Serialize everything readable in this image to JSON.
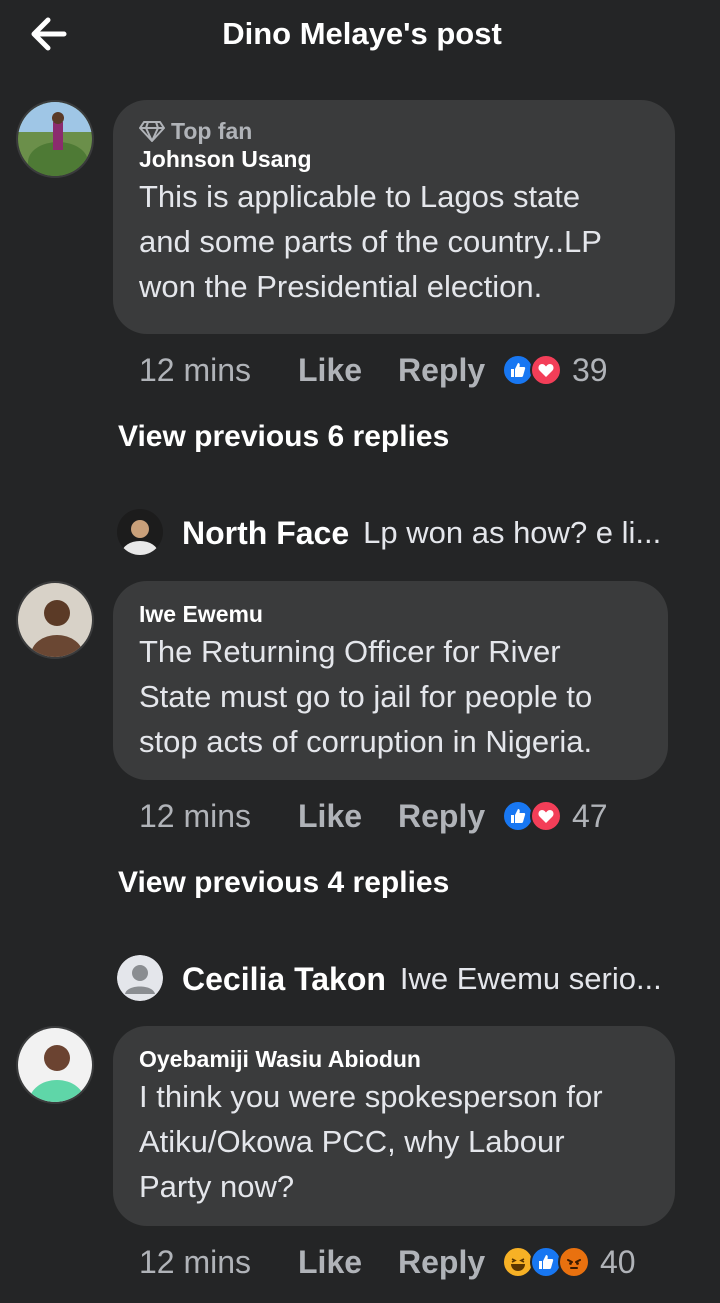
{
  "header": {
    "title": "Dino Melaye's post",
    "back_icon": "arrow-left-icon"
  },
  "comments": [
    {
      "badge": "Top fan",
      "author": "Johnson Usang",
      "text_lines": [
        "This is applicable to Lagos state",
        "and some parts of the country..LP",
        "won the Presidential election."
      ],
      "time": "12 mins",
      "like_label": "Like",
      "reply_label": "Reply",
      "reactions": [
        "like",
        "love"
      ],
      "reaction_count": "39",
      "view_previous": "View previous 6 replies",
      "latest_reply": {
        "name": "North Face",
        "text": "Lp won as how? e li..."
      }
    },
    {
      "author": "Iwe Ewemu",
      "text_lines": [
        "The Returning Officer for River",
        "State must go to jail for people to",
        "stop acts of corruption in Nigeria."
      ],
      "time": "12 mins",
      "like_label": "Like",
      "reply_label": "Reply",
      "reactions": [
        "like",
        "love"
      ],
      "reaction_count": "47",
      "view_previous": "View previous 4 replies",
      "latest_reply": {
        "name": "Cecilia Takon",
        "text": "Iwe Ewemu serio..."
      }
    },
    {
      "author": "Oyebamiji Wasiu Abiodun",
      "text_lines": [
        "I think you were spokesperson for",
        "Atiku/Okowa PCC, why Labour",
        "Party now?"
      ],
      "time": "12 mins",
      "like_label": "Like",
      "reply_label": "Reply",
      "reactions": [
        "haha",
        "like",
        "angry"
      ],
      "reaction_count": "40"
    }
  ],
  "colors": {
    "background": "#242526",
    "bubble": "#3a3b3c",
    "like_blue": "#1877f2",
    "love_red": "#f33e58"
  }
}
